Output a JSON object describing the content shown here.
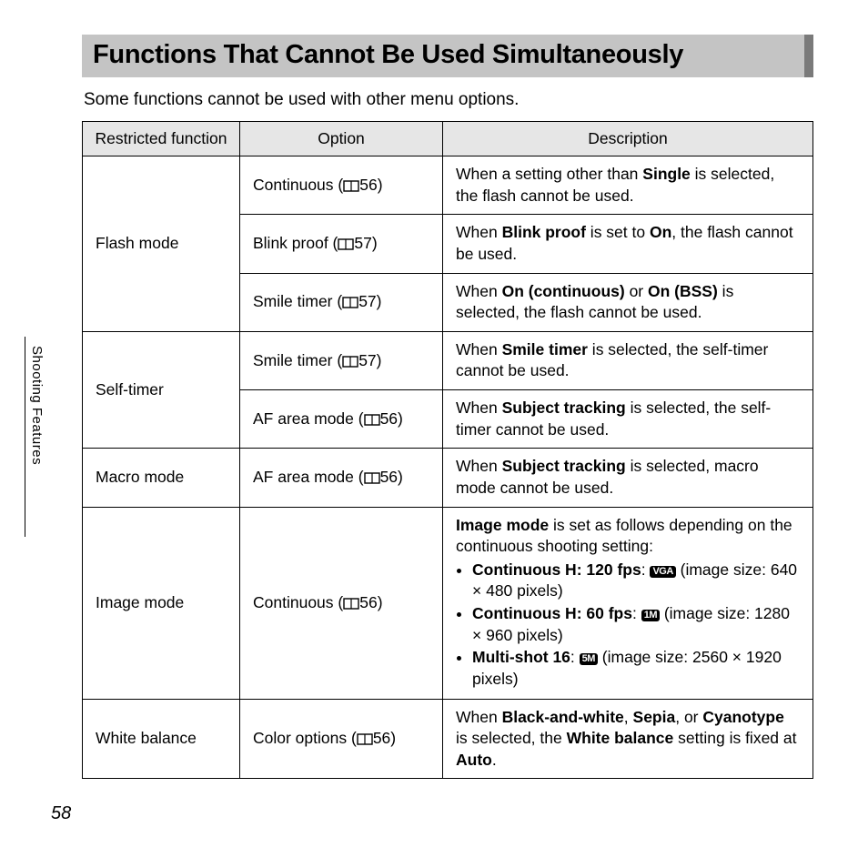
{
  "title": "Functions That Cannot Be Used Simultaneously",
  "intro": "Some functions cannot be used with other menu options.",
  "sideLabel": "Shooting Features",
  "pageNumber": "58",
  "headers": {
    "c1": "Restricted function",
    "c2": "Option",
    "c3": "Description"
  },
  "rows": {
    "flash": {
      "label": "Flash mode",
      "r1": {
        "optName": "Continuous (",
        "optRef": "56)",
        "desc_a": "When a setting other than ",
        "desc_b": "Single",
        "desc_c": " is selected, the flash cannot be used."
      },
      "r2": {
        "optName": "Blink proof (",
        "optRef": "57)",
        "desc_a": "When ",
        "desc_b": "Blink proof",
        "desc_c": " is set to ",
        "desc_d": "On",
        "desc_e": ", the flash cannot be used."
      },
      "r3": {
        "optName": "Smile timer (",
        "optRef": "57)",
        "desc_a": "When ",
        "desc_b": "On (continuous)",
        "desc_c": " or ",
        "desc_d": "On (BSS)",
        "desc_e": " is selected, the flash cannot be used."
      }
    },
    "selftimer": {
      "label": "Self-timer",
      "r1": {
        "optName": "Smile timer (",
        "optRef": "57)",
        "desc_a": "When ",
        "desc_b": "Smile timer",
        "desc_c": " is selected, the self-timer cannot be used."
      },
      "r2": {
        "optName": "AF area mode (",
        "optRef": "56)",
        "desc_a": "When ",
        "desc_b": "Subject tracking",
        "desc_c": " is selected, the self-timer cannot be used."
      }
    },
    "macro": {
      "label": "Macro mode",
      "optName": "AF area mode (",
      "optRef": "56)",
      "desc_a": "When ",
      "desc_b": "Subject tracking",
      "desc_c": " is selected, macro mode cannot be used."
    },
    "imagemode": {
      "label": "Image mode",
      "optName": "Continuous (",
      "optRef": "56)",
      "lead_a": "Image mode",
      "lead_b": " is set as follows depending on the continuous shooting setting:",
      "b1_a": "Continuous H: 120 fps",
      "b1_badge": "VGA",
      "b1_c": " (image size: 640 × 480 pixels)",
      "b2_a": "Continuous H: 60 fps",
      "b2_badge": "1M",
      "b2_c": " (image size: 1280 × 960 pixels)",
      "b3_a": "Multi-shot 16",
      "b3_badge": "5M",
      "b3_c": " (image size: 2560 × 1920 pixels)"
    },
    "wb": {
      "label": "White balance",
      "optName": "Color options (",
      "optRef": "56)",
      "desc_a": "When ",
      "desc_b": "Black-and-white",
      "desc_c": ", ",
      "desc_d": "Sepia",
      "desc_e": ", or ",
      "desc_f": "Cyanotype",
      "desc_g": " is selected, the ",
      "desc_h": "White balance",
      "desc_i": " setting is fixed at ",
      "desc_j": "Auto",
      "desc_k": "."
    }
  }
}
